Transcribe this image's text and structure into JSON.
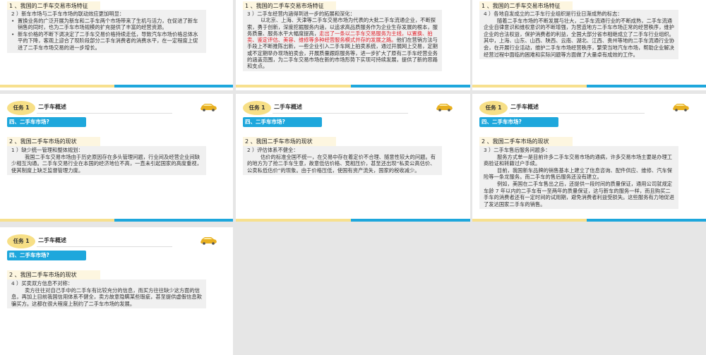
{
  "task_label": "任务 1",
  "task_title": "二手车概述",
  "section_label": "四、二手车市场?",
  "status_heading": "2 、我国二手车市场的现状",
  "feature_heading": "1 、我国的二手车交易市场特征",
  "slides": [
    {
      "sub": "2 ）新车市场与二手车市场的联动效应更加明显：",
      "bullets": [
        "置换业务的广泛开展为新车和二手车两个市场带来了生机与活力，在促进了新车销售的同时，也为二手车市场规模的扩充提供了丰富的经营资源。",
        "新车价格的不断下调决定了二手车交易价格持续走低，导致汽车市场价格总体水平的下降，客观上迎合了现阶段部分二手车消费者的消费水平，在一定程度上促进了二手车市场交易的进一步增长。"
      ]
    },
    {
      "sub": "3 ）二手车经营内涵得到进一步的拓展和深化：",
      "p1": "以北京、上海、天津等二手车交易市场为代表的大批二手车流通企业，不断探索，勇于创新，深度挖掘服务内涵，以追求高品质服务作为企业生存发展的根本，服务质量、服务水平大幅度提高，",
      "red": "走出了一条以二手车交易服务为主线，以置换、拍卖、鉴定评估、美容、维修等多种经营服务模式并存的发展之路。",
      "p2": "他们在营销方法与手段上不断推陈出新，一些企业引入二手车网上拍卖系统，通过开展网上交易，定期或不定期举办现场拍卖会，开展质量跟踪服务等，进一步扩大了原有二手车经营业务的涵盖范围，为二手车交易市场在新的市场形势下实现可持续发展，提供了新的思路和支点。"
    },
    {
      "sub": "4 ）各地自发成立的二手车行业组织是行业日渐成熟的标志：",
      "p1": "随着二手车市场的不断发展与壮大，二手车流通行业的不断成熟，二手车流通企业自律意识和维权意识的不断增强，为营造地方二手车市场正常的经营秩序，维护企业的合法权益，保护消费者的利益，全国大部分省市相继成立了二手车行业组织。其中，上海、山东、山西、陕西、云南、湖北、江西、贵州等地的二手车流通行业协会，在开展行业活动，维护二手车市场经营秩序，繁荣当地汽车市场，帮助企业解决经营过程中面临的困难和实际问题等方面做了大量卓有成效的工作。"
    },
    {
      "sub": "1 ）缺少统一管理和整体规划：",
      "p1": "我国二手车交易市场由于历史原因存在多头管理问题，行业间及经营企业间缺少相互沟通。二手车交易行业在本国的经济地位不高，一直未引起国家的高度重视，使其制度上缺乏监督管理力度。"
    },
    {
      "sub": "2 ）评估体系不健全：",
      "p1": "估价的标准全国不统一，在交易中存在着定价不合理、随意性较大的问题。有的地方为了抢二手车生意，故意低估价格、竞相压价，甚至还出现“私卖公高估价、公卖私低估价”的现象。由于价格压低，使国有资产流失，国家的税收减少。"
    },
    {
      "sub": "3 ）二手车售后服务问题多：",
      "p1": "服务方式单一是目前许多二手车交易市场的通病，许多交易市场主要是办理工商验证和转籍过户手续。",
      "p2": "目前，我国新车品牌的销售基本上建立了信息咨询、配件供应、维修、汽车保险等一条龙服务。而二手车的售后服务还没有建立。",
      "p3": "例如，美国在二手车售出之后，还提供一段时间的质量保证，通用公司就规定车龄 7 年以内的二手车有一至两年的质量保证，这与新车的服务一样，而且购买二手车的消费者还有一定时间的试用期，避免消费者利益受损失。这些服务有力地促进了发达国家二手车的销售。"
    },
    {
      "sub": "4 ）买卖双方信息不对称：",
      "p1": "卖方往往对自己手中的二手车有比较充分的信息，而买方往往缺少这方面的信息，再加上目前我国信用体系不健全，卖方故意隐瞒某些瑕疵，甚至提供虚假信息欺骗买方。这都在很大程度上制约了二手车市场的发展。"
    }
  ]
}
